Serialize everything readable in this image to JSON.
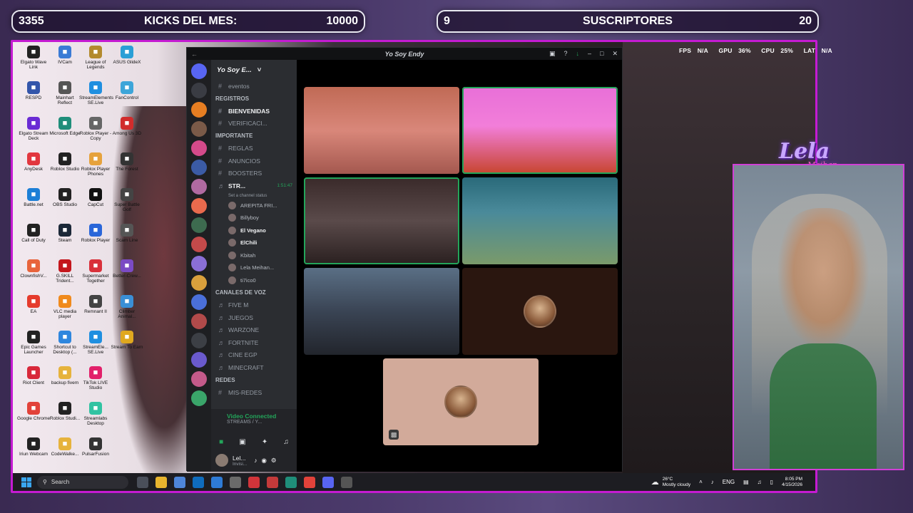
{
  "overlay": {
    "left_bar": {
      "count": "3355",
      "label": "KICKS DEL MES:",
      "goal": "10000"
    },
    "right_bar": {
      "count": "9",
      "label": "SUSCRIPTORES",
      "goal": "20"
    },
    "stats": {
      "fps_label": "FPS",
      "fps": "N/A",
      "gpu_label": "GPU",
      "gpu": "36%",
      "cpu_label": "CPU",
      "cpu": "25%",
      "lat_label": "LAT",
      "lat": "N/A"
    },
    "logo": {
      "name": "Lela",
      "sub": "Meihan"
    },
    "border_color": "#c51bd2"
  },
  "desktop_icons": [
    [
      "Elgato Wave Link",
      "#222"
    ],
    [
      "IVCam",
      "#3a7bd5"
    ],
    [
      "League of Legends",
      "#b38a2e"
    ],
    [
      "ASUS GlideX",
      "#2a9fd6"
    ],
    [
      "RESPD",
      "#3355aa"
    ],
    [
      "Mainhart Reflect",
      "#555"
    ],
    [
      "StreamElements SE.Live",
      "#1f8fe0"
    ],
    [
      "FanControl",
      "#3da5d9"
    ],
    [
      "Elgato Stream Deck",
      "#6a2bd4"
    ],
    [
      "Microsoft Edge",
      "#1f8e7a"
    ],
    [
      "Roblox Player - Copy",
      "#666"
    ],
    [
      "Among Us 3D",
      "#d12c2c"
    ],
    [
      "AnyDesk",
      "#e2373f"
    ],
    [
      "Roblox Studio",
      "#222"
    ],
    [
      "Roblox Player Phones",
      "#e6a23c"
    ],
    [
      "The Forest",
      "#333"
    ],
    [
      "Battle.net",
      "#1c7fd6"
    ],
    [
      "OBS Studio",
      "#222"
    ],
    [
      "CapCut",
      "#111"
    ],
    [
      "Super Battle Golf",
      "#444"
    ],
    [
      "Call of Duty",
      "#222"
    ],
    [
      "Steam",
      "#1b2838"
    ],
    [
      "Roblox Player",
      "#2a66d9"
    ],
    [
      "Scam Line",
      "#555"
    ],
    [
      "ClownfishV...",
      "#e8643c"
    ],
    [
      "G.SKILL Trident...",
      "#c4161c"
    ],
    [
      "Supermarket Together",
      "#d9303a"
    ],
    [
      "Better-Crew...",
      "#7b4bc4"
    ],
    [
      "EA",
      "#e53b2c"
    ],
    [
      "VLC media player",
      "#f08a1c"
    ],
    [
      "Remnant II",
      "#444"
    ],
    [
      "Climber Animal...",
      "#3a8fd6"
    ],
    [
      "Epic Games Launcher",
      "#222"
    ],
    [
      "Shortcut to Desktop (...",
      "#2e86de"
    ],
    [
      "StreamEle... SE.Live",
      "#1f8fe0"
    ],
    [
      "Stream To Earn",
      "#e0a81f"
    ],
    [
      "Riot Client",
      "#d8283a"
    ],
    [
      "backup fivem",
      "#e6b33c"
    ],
    [
      "TikTok LIVE Studio",
      "#e2206a"
    ],
    [
      "",
      ""
    ],
    [
      "Google Chrome",
      "#e2423a"
    ],
    [
      "Roblox Studi...",
      "#222"
    ],
    [
      "Streamlabs Desktop",
      "#31c3a2"
    ],
    [
      "",
      ""
    ],
    [
      "Iriun Webcam",
      "#222"
    ],
    [
      "CodeWalke...",
      "#e6b33c"
    ],
    [
      "PulsarFusion",
      "#333"
    ],
    [
      "",
      ""
    ]
  ],
  "discord": {
    "window_title": "Yo Soy Endy",
    "server_name": "Yo Soy E...",
    "channels": [
      {
        "type": "text",
        "label": "eventos"
      },
      {
        "type": "cat",
        "label": "REGISTROS"
      },
      {
        "type": "text",
        "label": "BIENVENIDAS",
        "bold": true
      },
      {
        "type": "text",
        "label": "VERIFICACI..."
      },
      {
        "type": "cat",
        "label": "IMPORTANTE"
      },
      {
        "type": "text",
        "label": "REGLAS"
      },
      {
        "type": "text",
        "label": "ANUNCIOS"
      },
      {
        "type": "text",
        "label": "BOOSTERS"
      },
      {
        "type": "voice",
        "label": "STR...",
        "active": true,
        "time": "1:51:47",
        "status": "Set a channel status"
      },
      {
        "type": "user",
        "label": "AREPITA FRI..."
      },
      {
        "type": "user",
        "label": "Billyboy"
      },
      {
        "type": "user",
        "label": "El Vegano",
        "bold": true
      },
      {
        "type": "user",
        "label": "ElChili",
        "bold": true
      },
      {
        "type": "user",
        "label": "Kbitah"
      },
      {
        "type": "user",
        "label": "Lela Meihan..."
      },
      {
        "type": "user",
        "label": "ti7ico0"
      },
      {
        "type": "cat",
        "label": "CANALES DE VOZ"
      },
      {
        "type": "voicech",
        "label": "FIVE M"
      },
      {
        "type": "voicech",
        "label": "JUEGOS"
      },
      {
        "type": "voicech",
        "label": "WARZONE"
      },
      {
        "type": "voicech",
        "label": "FORTNITE"
      },
      {
        "type": "voicech",
        "label": "CINE EGP"
      },
      {
        "type": "voicech",
        "label": "MINECRAFT"
      },
      {
        "type": "cat",
        "label": "REDES"
      },
      {
        "type": "text",
        "label": "MIS-REDES"
      }
    ],
    "voice_status": {
      "title": "Video Connected",
      "channel": "STREAMS / Y..."
    },
    "user": {
      "name": "Lel...",
      "status": "Invisi..."
    },
    "tiles": [
      {
        "name": "video-tile-1",
        "bg": "linear-gradient(180deg,#c06a55 0%,#d9877a 50%,#a4584f 100%)",
        "speaking": false
      },
      {
        "name": "video-tile-2",
        "bg": "linear-gradient(180deg,#e86fd8 0%,#f27ed9 45%,#c7452e 100%)",
        "speaking": true
      },
      {
        "name": "video-tile-3",
        "bg": "linear-gradient(180deg,#3a2a2a 0%,#5a4a4a 50%,#2a2020 100%)",
        "speaking": true
      },
      {
        "name": "video-tile-4",
        "bg": "linear-gradient(180deg,#2a6a7a 0%,#4a8a9a 40%,#7a9a6a 100%)",
        "speaking": false
      },
      {
        "name": "video-tile-5",
        "bg": "linear-gradient(180deg,#5a6f85 0%,#3a4454 50%,#22252c 100%)",
        "speaking": false
      },
      {
        "name": "video-tile-6",
        "bg": "#2a160f",
        "speaking": false,
        "avatar": true
      },
      {
        "name": "video-tile-7",
        "bg": "#d2aa9a",
        "speaking": false,
        "avatar": true
      }
    ]
  },
  "taskbar": {
    "search_placeholder": "Search",
    "weather_temp": "26°C",
    "weather_desc": "Mostly cloudy",
    "lang": "ENG",
    "time": "8:05 PM",
    "date": "4/15/2026",
    "apps": [
      "#4a4f5a",
      "#e8b52e",
      "#4e86d9",
      "#0f6cbd",
      "#2e7bd6",
      "#6a6a6a",
      "#d1343a",
      "#c43a3a",
      "#1f8e7a",
      "#e2423a",
      "#5865f2",
      "#555"
    ]
  }
}
